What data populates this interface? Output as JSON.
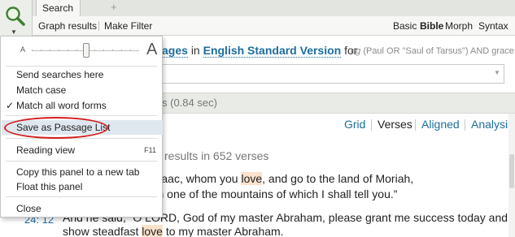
{
  "tabs": {
    "active_label": "Search",
    "add_label": "+"
  },
  "toolbar": {
    "graph_results": "Graph results",
    "make_filter": "Make Filter",
    "modes": [
      "Basic",
      "Bible",
      "Morph",
      "Syntax"
    ],
    "active_mode": "Bible"
  },
  "query": {
    "scope_link": "ages",
    "in_word": "in",
    "version_link": "English Standard Version",
    "for_word": "for",
    "example_prefix": "eg",
    "example_query": "(Paul OR \"Saul of Tarsus\") AND grace"
  },
  "status": {
    "text": "s (0.84 sec)"
  },
  "view_tabs": [
    "Grid",
    "Verses",
    "Aligned",
    "Analysis"
  ],
  "active_view": "Verses",
  "results": {
    "count_text": "results in 652 verses",
    "line1_a": "on, your only son Isaac, whom you ",
    "line1_hl": "love",
    "line1_b": ", and go to the land of Moriah,",
    "line2": "s a burnt offering on one of the mountains of which I shall tell you.”",
    "verse_ref": "24: 12",
    "line3": "And he said, “O LORD, God of my master Abraham, please grant me success today and",
    "line4_a": "show steadfast ",
    "line4_hl": "love",
    "line4_b": " to my master Abraham."
  },
  "menu": {
    "slider_small": "A",
    "slider_big": "A",
    "send_searches_here": "Send searches here",
    "match_case": "Match case",
    "match_all_word_forms": "Match all word forms",
    "match_all_checked": "✓",
    "save_as_passage_list": "Save as Passage List",
    "reading_view": "Reading view",
    "reading_view_shortcut": "F11",
    "copy_panel": "Copy this panel to a new tab",
    "float_panel": "Float this panel",
    "close": "Close"
  },
  "colors": {
    "link": "#1d6d9e",
    "highlight": "#fbe2cc",
    "annotation": "#d21f1f"
  }
}
